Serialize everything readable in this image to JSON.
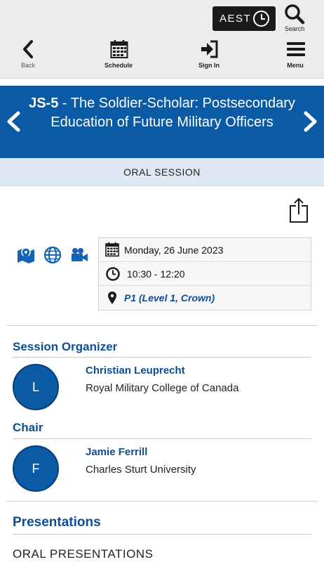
{
  "toolbar": {
    "timezone": "AEST",
    "search_label": "Search",
    "back_label": "Back",
    "schedule_label": "Schedule",
    "signin_label": "Sign In",
    "menu_label": "Menu"
  },
  "session": {
    "code": "JS-5",
    "title": " - The Soldier-Scholar: Postsecondary Education of Future Military Officers",
    "type": "ORAL SESSION",
    "date": "Monday, 26 June 2023",
    "time": "10:30 - 12:20",
    "location": "P1 (Level 1, Crown)"
  },
  "organizer": {
    "heading": "Session Organizer",
    "initial": "L",
    "name": "Christian Leuprecht",
    "affiliation": "Royal Military College of Canada"
  },
  "chair": {
    "heading": "Chair",
    "initial": "F",
    "name": "Jamie Ferrill",
    "affiliation": "Charles Sturt University"
  },
  "presentations": {
    "heading": "Presentations",
    "subheading": "ORAL PRESENTATIONS"
  },
  "colors": {
    "brand_blue": "#0b5aa6",
    "link_blue": "#0b4e95",
    "session_type_bg": "#dde8f3"
  }
}
